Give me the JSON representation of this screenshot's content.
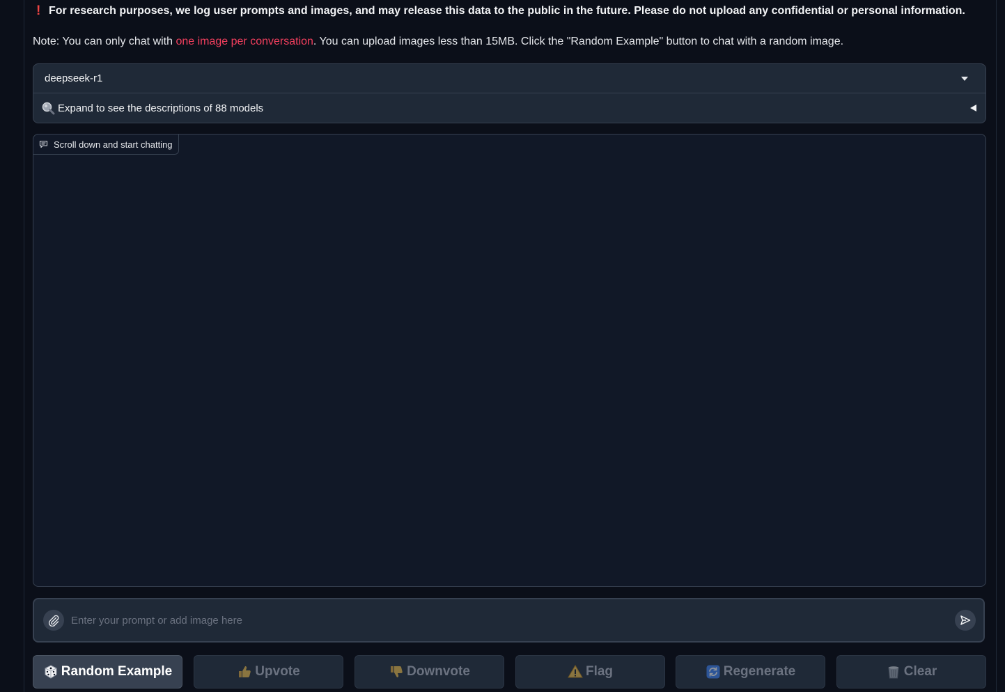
{
  "notice": {
    "warning_icon": "exclamation-icon",
    "warning_text": "For research purposes, we log user prompts and images, and may release this data to the public in the future. Please do not upload any confidential or personal information.",
    "note_prefix": "Note: You can only chat with ",
    "note_highlight": "one image per conversation",
    "note_suffix": ". You can upload images less than 15MB. Click the \"Random Example\" button to chat with a random image."
  },
  "model_selector": {
    "selected": "deepseek-r1",
    "accordion_label": "Expand to see the descriptions of 88 models"
  },
  "chatbot": {
    "label": "Scroll down and start chatting"
  },
  "input": {
    "placeholder": "Enter your prompt or add image here",
    "value": ""
  },
  "buttons": {
    "random_example": "Random Example",
    "upvote": "Upvote",
    "downvote": "Downvote",
    "flag": "Flag",
    "regenerate": "Regenerate",
    "clear": "Clear"
  },
  "colors": {
    "background": "#0b0f19",
    "panel": "#1f2937",
    "border": "#374151",
    "highlight": "#f43f5e",
    "warning": "#ef4444"
  }
}
